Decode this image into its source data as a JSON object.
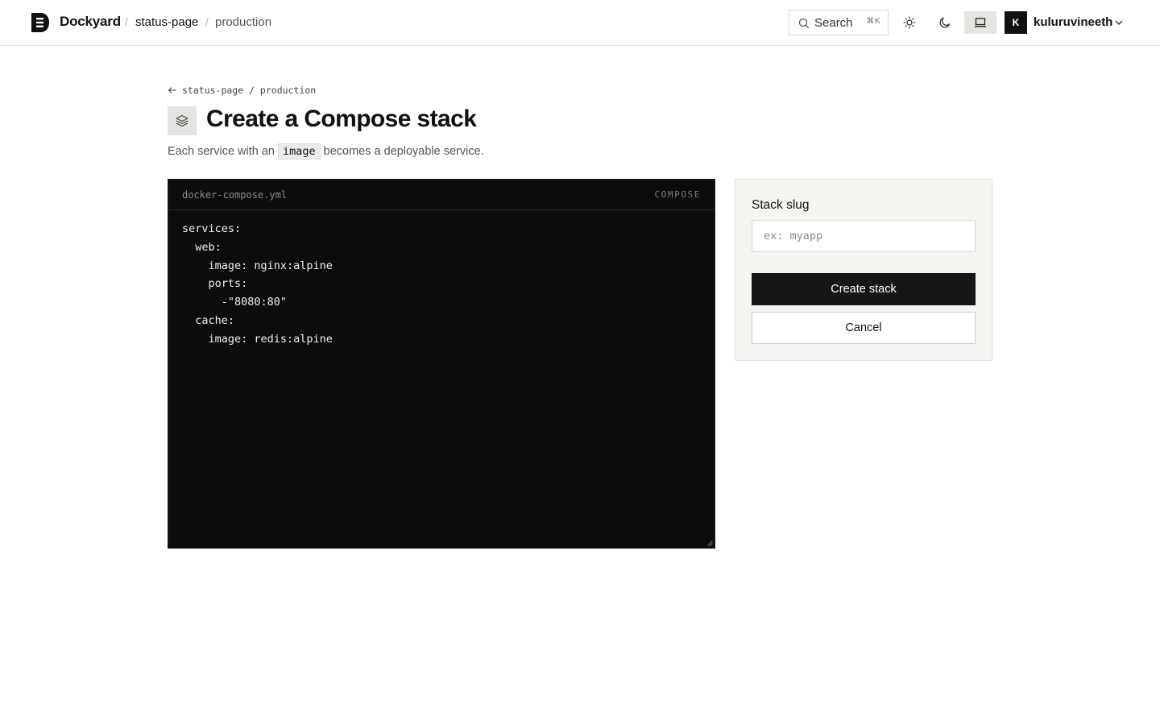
{
  "header": {
    "brand": "Dockyard",
    "breadcrumb_separator": "/",
    "project": "status-page",
    "environment": "production",
    "search_label": "Search",
    "search_shortcut": "⌘K",
    "user_initial": "K",
    "username": "kuluruvineeth"
  },
  "page": {
    "back_link": "status-page / production",
    "title": "Create a Compose stack",
    "subtitle_before": "Each service with an",
    "subtitle_code": "image",
    "subtitle_after": "becomes a deployable service."
  },
  "editor": {
    "filename": "docker-compose.yml",
    "tag": "COMPOSE",
    "content": "services:\n  web:\n    image: nginx:alpine\n    ports:\n      -\"8080:80\"\n  cache:\n    image: redis:alpine"
  },
  "form": {
    "slug_label": "Stack slug",
    "slug_value": "",
    "slug_placeholder": "ex: myapp",
    "submit_label": "Create stack",
    "cancel_label": "Cancel"
  },
  "icons": {
    "brand": "dockyard-logo-icon",
    "search": "search-icon",
    "theme_light": "sun-icon",
    "theme_dark": "moon-icon",
    "theme_system": "laptop-icon",
    "user_menu": "chevron-down-icon",
    "back": "arrow-left-icon",
    "title": "layers-icon"
  },
  "colors": {
    "primary": "#161616",
    "editor_background": "#0c0c0c",
    "panel_background": "#f6f5f1"
  }
}
